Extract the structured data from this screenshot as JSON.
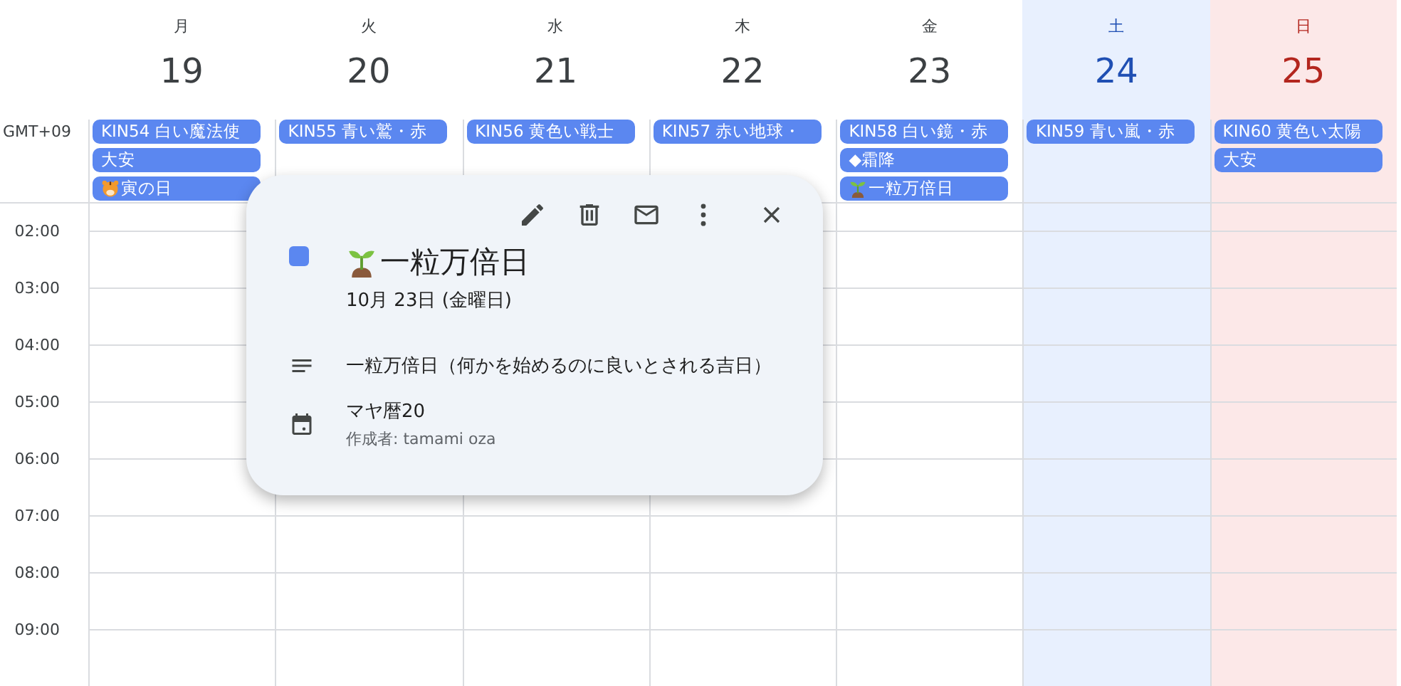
{
  "timezone": "GMT+09",
  "days": [
    {
      "weekday": "月",
      "date": "19",
      "kind": "weekday",
      "events": [
        {
          "title": "KIN54 白い魔法使"
        },
        {
          "title": "大安"
        },
        {
          "title": "寅の日",
          "kind": "tiger"
        }
      ]
    },
    {
      "weekday": "火",
      "date": "20",
      "kind": "weekday",
      "events": [
        {
          "title": "KIN55 青い鷲・赤"
        }
      ]
    },
    {
      "weekday": "水",
      "date": "21",
      "kind": "weekday",
      "events": [
        {
          "title": "KIN56 黄色い戦士"
        }
      ]
    },
    {
      "weekday": "木",
      "date": "22",
      "kind": "weekday",
      "events": [
        {
          "title": "KIN57 赤い地球・"
        }
      ]
    },
    {
      "weekday": "金",
      "date": "23",
      "kind": "weekday",
      "events": [
        {
          "title": "KIN58 白い鏡・赤"
        },
        {
          "title": "◆霜降"
        },
        {
          "title": "一粒万倍日",
          "kind": "sprout"
        }
      ]
    },
    {
      "weekday": "土",
      "date": "24",
      "kind": "saturday",
      "events": [
        {
          "title": "KIN59 青い嵐・赤"
        }
      ]
    },
    {
      "weekday": "日",
      "date": "25",
      "kind": "sunday",
      "events": [
        {
          "title": "KIN60 黄色い太陽"
        },
        {
          "title": "大安"
        }
      ]
    }
  ],
  "times": [
    "02:00",
    "03:00",
    "04:00",
    "05:00",
    "06:00",
    "07:00",
    "08:00",
    "09:00"
  ],
  "popup": {
    "title": "一粒万倍日",
    "kind": "sprout",
    "color": "#5b87f0",
    "date": "10月 23日 (金曜日)",
    "description": "一粒万倍日（何かを始めるのに良いとされる吉日）",
    "calendar": "マヤ暦20",
    "creator": "作成者: tamami oza"
  }
}
